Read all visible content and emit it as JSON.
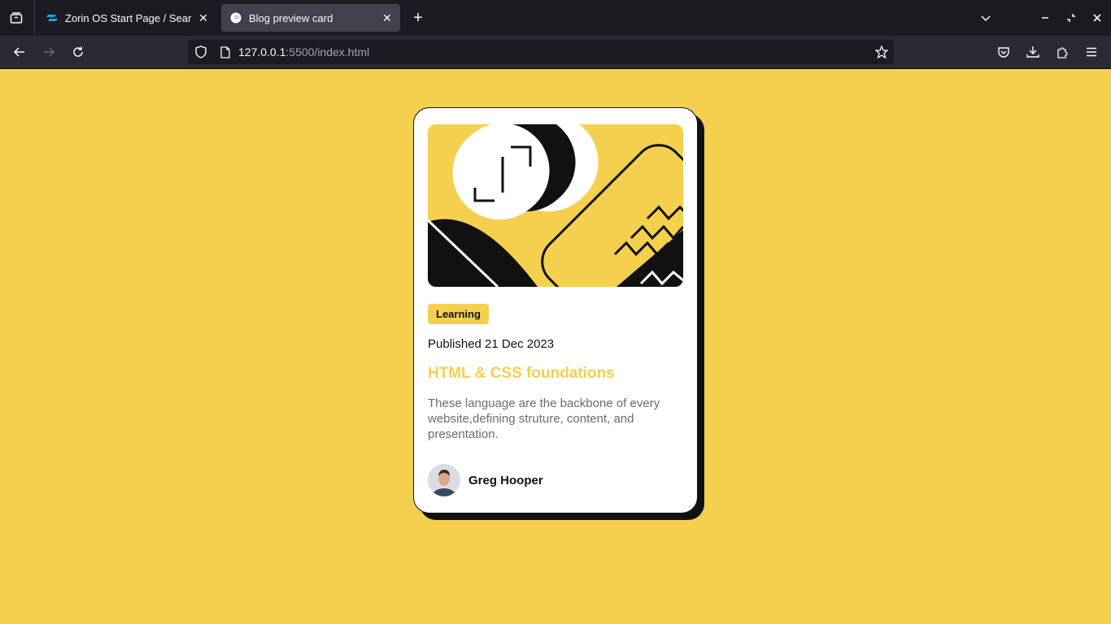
{
  "browser": {
    "tabs": [
      {
        "title": "Zorin OS Start Page / Sear",
        "active": false
      },
      {
        "title": "Blog preview card",
        "active": true
      }
    ],
    "url_host": "127.0.0.1",
    "url_rest": ":5500/index.html"
  },
  "card": {
    "tag": "Learning",
    "published": "Published 21 Dec 2023",
    "title": "HTML & CSS foundations",
    "description": "These language are the backbone of every website,defining struture, content, and presentation.",
    "author": "Greg Hooper"
  },
  "colors": {
    "accent_yellow": "#f4d04e",
    "dark": "#111111",
    "muted_text": "#6b6b6b"
  }
}
